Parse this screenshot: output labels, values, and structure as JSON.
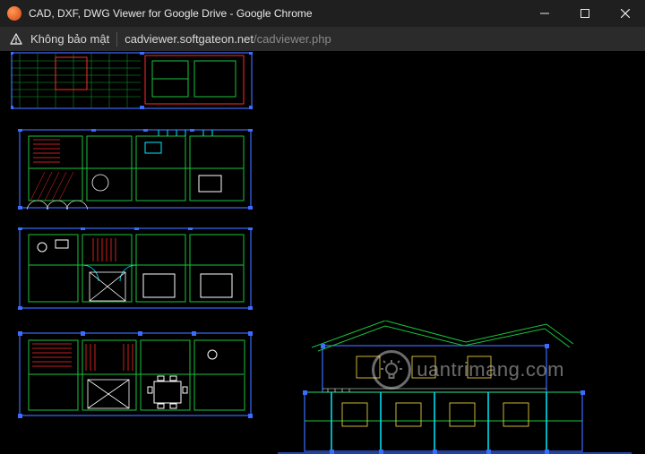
{
  "window": {
    "title": "CAD, DXF, DWG Viewer for Google Drive - Google Chrome",
    "controls": {
      "minimize": "minimize",
      "maximize": "maximize",
      "close": "close"
    }
  },
  "address": {
    "security_label": "Không bảo mật",
    "host": "cadviewer.softgateon.net",
    "path": "/cadviewer.php"
  },
  "icons": {
    "app": "chrome-app-icon",
    "warning": "warning-triangle-icon"
  },
  "watermark": {
    "text": "uantrimang.com"
  },
  "drawings": [
    {
      "id": "plan-1",
      "label": "elevation-top"
    },
    {
      "id": "plan-2",
      "label": "floor-plan-a"
    },
    {
      "id": "plan-3",
      "label": "floor-plan-b"
    },
    {
      "id": "plan-4",
      "label": "floor-plan-c"
    },
    {
      "id": "plan-5",
      "label": "house-elevation"
    }
  ],
  "colors": {
    "blue": "#3b6bff",
    "green": "#17c33d",
    "red": "#ff2a2a",
    "cyan": "#00eaff",
    "yellow": "#ffe042",
    "white": "#ffffff"
  }
}
